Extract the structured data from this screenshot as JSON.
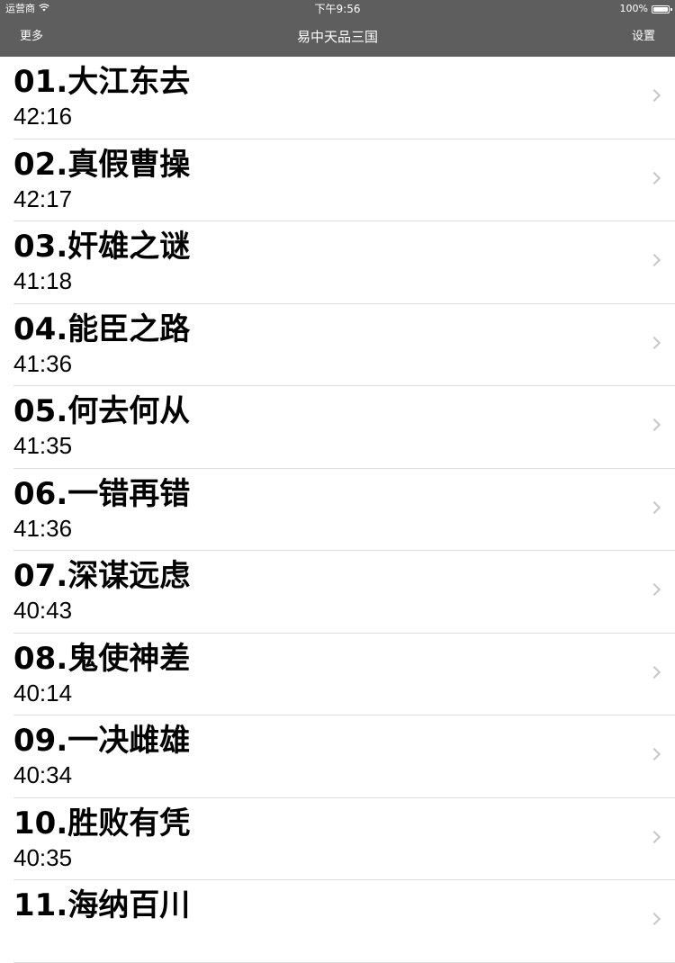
{
  "status_bar": {
    "carrier": "运营商",
    "time": "下午9:56",
    "battery": "100%"
  },
  "nav": {
    "left_label": "更多",
    "title": "易中天品三国",
    "right_label": "设置"
  },
  "episodes": [
    {
      "title": "01.大江东去",
      "duration": "42:16"
    },
    {
      "title": "02.真假曹操",
      "duration": "42:17"
    },
    {
      "title": "03.奸雄之谜",
      "duration": "41:18"
    },
    {
      "title": "04.能臣之路",
      "duration": "41:36"
    },
    {
      "title": "05.何去何从",
      "duration": "41:35"
    },
    {
      "title": "06.一错再错",
      "duration": "41:36"
    },
    {
      "title": "07.深谋远虑",
      "duration": "40:43"
    },
    {
      "title": "08.鬼使神差",
      "duration": "40:14"
    },
    {
      "title": "09.一决雌雄",
      "duration": "40:34"
    },
    {
      "title": "10.胜败有凭",
      "duration": "40:35"
    },
    {
      "title": "11.海纳百川",
      "duration": ""
    }
  ]
}
